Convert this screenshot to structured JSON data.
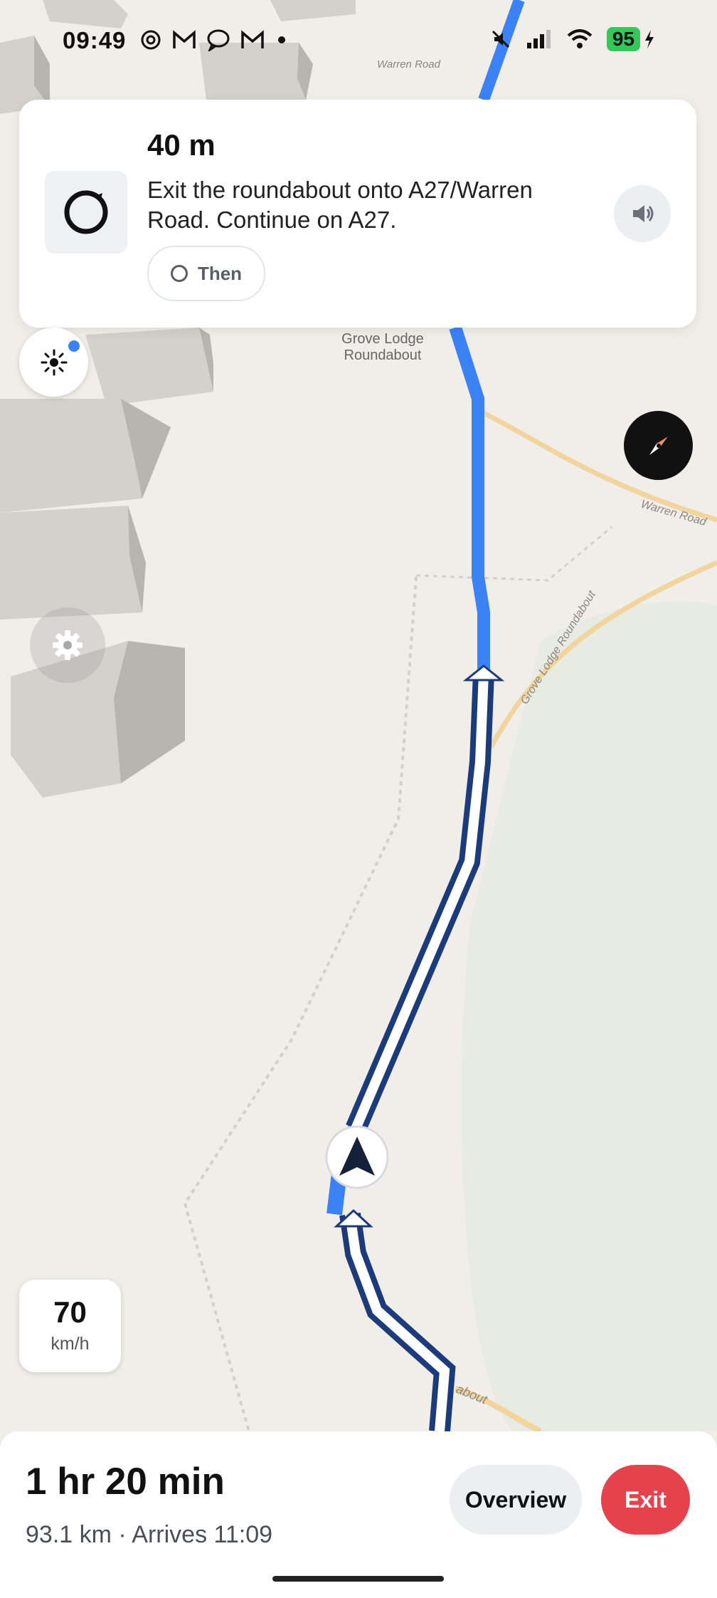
{
  "status_bar": {
    "time": "09:49",
    "battery": "95",
    "notification_icons": [
      "threads-icon",
      "gmail-icon",
      "chat-icon",
      "gmail-icon",
      "dot"
    ],
    "system_icons": [
      "mute-icon",
      "signal-icon",
      "wifi-icon",
      "battery-icon",
      "charging-icon"
    ]
  },
  "instruction_card": {
    "distance": "40 m",
    "instruction": "Exit the roundabout onto A27/Warren Road. Continue on A27.",
    "then_label": "Then",
    "maneuver_icon": "roundabout-icon",
    "audio_icon": "speaker-icon"
  },
  "map": {
    "labels": {
      "place": "Grove Lodge\nRoundabout",
      "place_line1": "Grove Lodge",
      "place_line2": "Roundabout",
      "road_warren": "Warren Road",
      "road_warren_top": "Warren Road",
      "road_grove": "Grove Lodge Roundabout",
      "road_bottom": "about"
    },
    "colors": {
      "route": "#3b82f6",
      "route_outline": "#1b3b7a",
      "minor_road": "#f3d7a1",
      "building": "#c9c7c2"
    }
  },
  "controls": {
    "brightness_icon": "brightness-icon",
    "compass_icon": "compass-icon",
    "settings_icon": "gear-icon"
  },
  "speed": {
    "value": "70",
    "unit": "km/h"
  },
  "trip": {
    "duration": "1 hr 20 min",
    "summary": "93.1 km · Arrives 11:09",
    "overview_label": "Overview",
    "exit_label": "Exit"
  },
  "colors": {
    "exit_button": "#e5424d",
    "battery": "#34c759",
    "accent": "#3b82f6"
  }
}
